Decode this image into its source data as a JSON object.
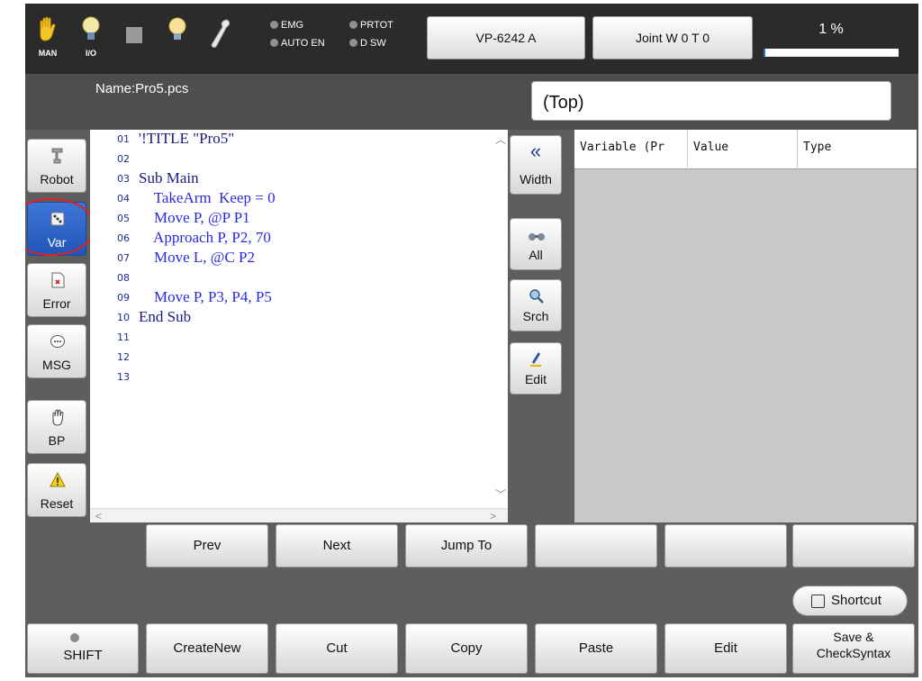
{
  "top": {
    "mode_label": "MAN",
    "io_label": "I/O",
    "lamps": [
      "EMG",
      "PRTOT",
      "AUTO EN",
      "D SW"
    ],
    "robot_model": "VP-6242 A",
    "joint_tool": "Joint W 0 T 0",
    "speed_percent": "1 %",
    "speed_value": 1
  },
  "file": {
    "name": "Name:Pro5.pcs",
    "position_box": "(Top)"
  },
  "left_buttons": [
    "Robot",
    "Var",
    "Error",
    "MSG",
    "BP",
    "Reset"
  ],
  "active_left_button": "Var",
  "code": {
    "line_numbers": [
      "01",
      "02",
      "03",
      "04",
      "05",
      "06",
      "07",
      "08",
      "09",
      "10",
      "11",
      "12",
      "13"
    ],
    "lines": [
      {
        "no": "01",
        "text": "'!TITLE \"Pro5\"",
        "color": "#1a1a80"
      },
      {
        "no": "03",
        "text": "Sub Main",
        "color": "#1a1a80"
      },
      {
        "no": "04",
        "text": "    TakeArm  Keep = 0",
        "color": "#2a2ae0"
      },
      {
        "no": "05",
        "text": "    Move P, @P P1",
        "color": "#2a2ae0"
      },
      {
        "no": "06",
        "text": "    Approach P, P2, 70",
        "color": "#2a2ae0"
      },
      {
        "no": "07",
        "text": "    Move L, @C P2",
        "color": "#2a2ae0"
      },
      {
        "no": "09",
        "text": "    Move P, P3, P4, P5",
        "color": "#2a2ae0"
      },
      {
        "no": "10",
        "text": "End Sub",
        "color": "#1a1a80"
      }
    ]
  },
  "side_tools": {
    "width": "Width",
    "width_icon": "«",
    "all": "All",
    "search": "Srch",
    "edit": "Edit"
  },
  "var_table": {
    "headers": [
      "Variable (Pr",
      "Value",
      "Type"
    ]
  },
  "nav_row": [
    "Prev",
    "Next",
    "Jump To",
    "",
    "",
    ""
  ],
  "shortcut_label": "Shortcut",
  "bottom_row": [
    "SHIFT",
    "CreateNew",
    "Cut",
    "Copy",
    "Paste",
    "Edit"
  ],
  "save_button": {
    "line1": "Save &",
    "line2": "CheckSyntax"
  },
  "colors": {
    "keyword": "#1a1a80",
    "statement": "#2a2ae0",
    "number": "#1d9a9a",
    "active_button": "#2d62c8",
    "highlight_ring": "#e02020"
  }
}
